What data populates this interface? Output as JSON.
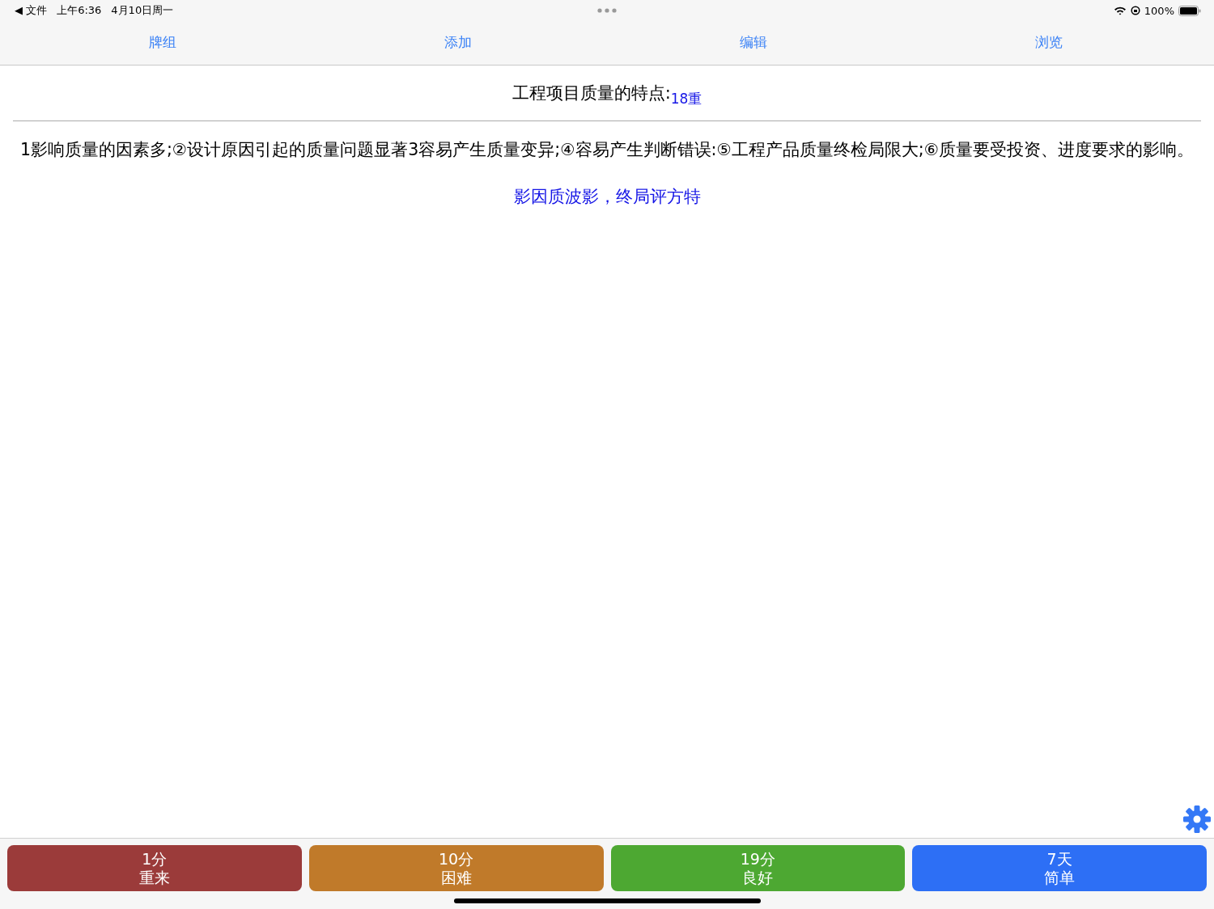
{
  "status_bar": {
    "back_app": "◀ 文件",
    "time": "上午6:36",
    "date": "4月10日周一",
    "battery": "100%"
  },
  "nav": [
    {
      "label": "牌组"
    },
    {
      "label": "添加"
    },
    {
      "label": "编辑"
    },
    {
      "label": "浏览"
    }
  ],
  "card": {
    "question": "工程项目质量的特点:",
    "tag": "18重",
    "answer": "1影响质量的因素多;②设计原因引起的质量问题显著3容易产生质量变异;④容易产生判断错误:⑤工程产品质量终检局限大;⑥质量要受投资、进度要求的影响。",
    "mnemonic": "影因质波影，终局评方特"
  },
  "answer_buttons": [
    {
      "interval": "1分",
      "label": "重来",
      "color": "#9b3b3a"
    },
    {
      "interval": "10分",
      "label": "困难",
      "color": "#c07a2a"
    },
    {
      "interval": "19分",
      "label": "良好",
      "color": "#4da832"
    },
    {
      "interval": "7天",
      "label": "简单",
      "color": "#2d6ff5"
    }
  ]
}
